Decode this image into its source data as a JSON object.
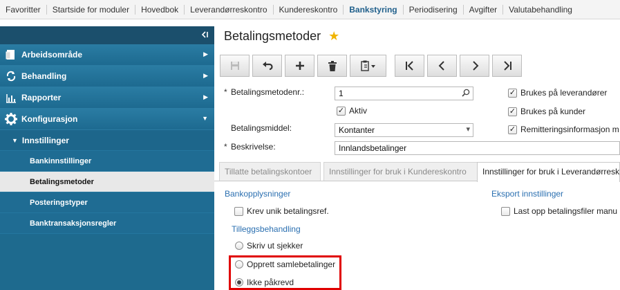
{
  "topnav": {
    "items": [
      "Favoritter",
      "Startside for moduler",
      "Hovedbok",
      "Leverandørreskontro",
      "Kundereskontro",
      "Bankstyring",
      "Periodisering",
      "Avgifter",
      "Valutabehandling"
    ],
    "active": "Bankstyring"
  },
  "sidebar": {
    "collapse_icon": "double-chevron-left-icon",
    "sections": [
      {
        "label": "Arbeidsområde",
        "icon": "workspace-icon"
      },
      {
        "label": "Behandling",
        "icon": "process-icon"
      },
      {
        "label": "Rapporter",
        "icon": "report-icon"
      },
      {
        "label": "Konfigurasjon",
        "icon": "gear-icon"
      }
    ],
    "group_label": "Innstillinger",
    "sub_items": [
      "Bankinnstillinger",
      "Betalingsmetoder",
      "Posteringstyper",
      "Banktransaksjonsregler"
    ],
    "selected": "Betalingsmetoder"
  },
  "main": {
    "title": "Betalingsmetoder",
    "form": {
      "number_label": "Betalingsmetodenr.:",
      "number_value": "1",
      "active_label": "Aktiv",
      "active_checked": true,
      "means_label": "Betalingsmiddel:",
      "means_value": "Kontanter",
      "description_label": "Beskrivelse:",
      "description_value": "Innlandsbetalinger",
      "required_marker": "*",
      "vendor_label": "Brukes på leverandører",
      "customer_label": "Brukes på kunder",
      "remittance_label": "Remitteringsinformasjon m"
    },
    "tabs": [
      "Tillatte betalingskontoer",
      "Innstillinger for bruk i Kundereskontro",
      "Innstillinger for bruk i Leverandørresk"
    ],
    "active_tab": 2,
    "sections": {
      "bank_info": "Bankopplysninger",
      "unique_ref_label": "Krev unik betalingsref.",
      "export": "Eksport innstillinger",
      "upload_label": "Last opp betalingsfiler manu",
      "additional": "Tilleggsbehandling",
      "radio_options": [
        "Skriv ut sjekker",
        "Opprett samlebetalinger",
        "Ikke påkrevd"
      ],
      "radio_selected": 2
    }
  },
  "colors": {
    "sidebar_bg": "#1e6a8e",
    "accent_link": "#2a6fb0",
    "highlight": "#e00000",
    "star": "#f0b400"
  }
}
